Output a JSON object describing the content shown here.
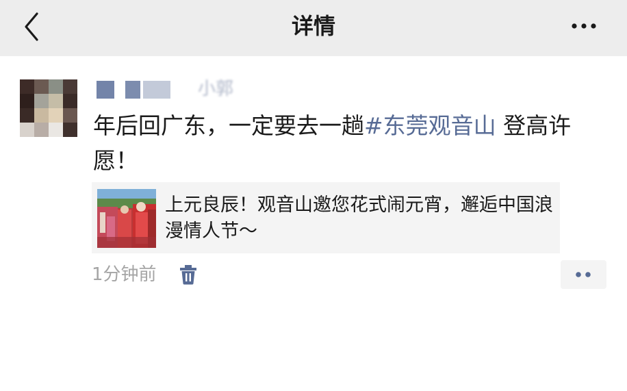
{
  "header": {
    "title": "详情",
    "back_icon": "back-chevron-icon",
    "more_icon": "more-dots-icon"
  },
  "post": {
    "author_name": "小郭",
    "text_before": "年后回广东，一定要去一趟",
    "hashtag": "#东莞观音山",
    "text_after": " 登高许愿！",
    "link_card": {
      "title": "上元良辰！观音山邀您花式闹元宵，邂逅中国浪漫情人节～"
    },
    "timestamp": "1分钟前",
    "delete_icon": "trash-icon",
    "action_icon": "comment-like-dots-icon"
  },
  "colors": {
    "navbar_bg": "#ededed",
    "link_blue": "#576b95",
    "time_gray": "#a5a5a5",
    "card_bg": "#f4f4f4"
  }
}
